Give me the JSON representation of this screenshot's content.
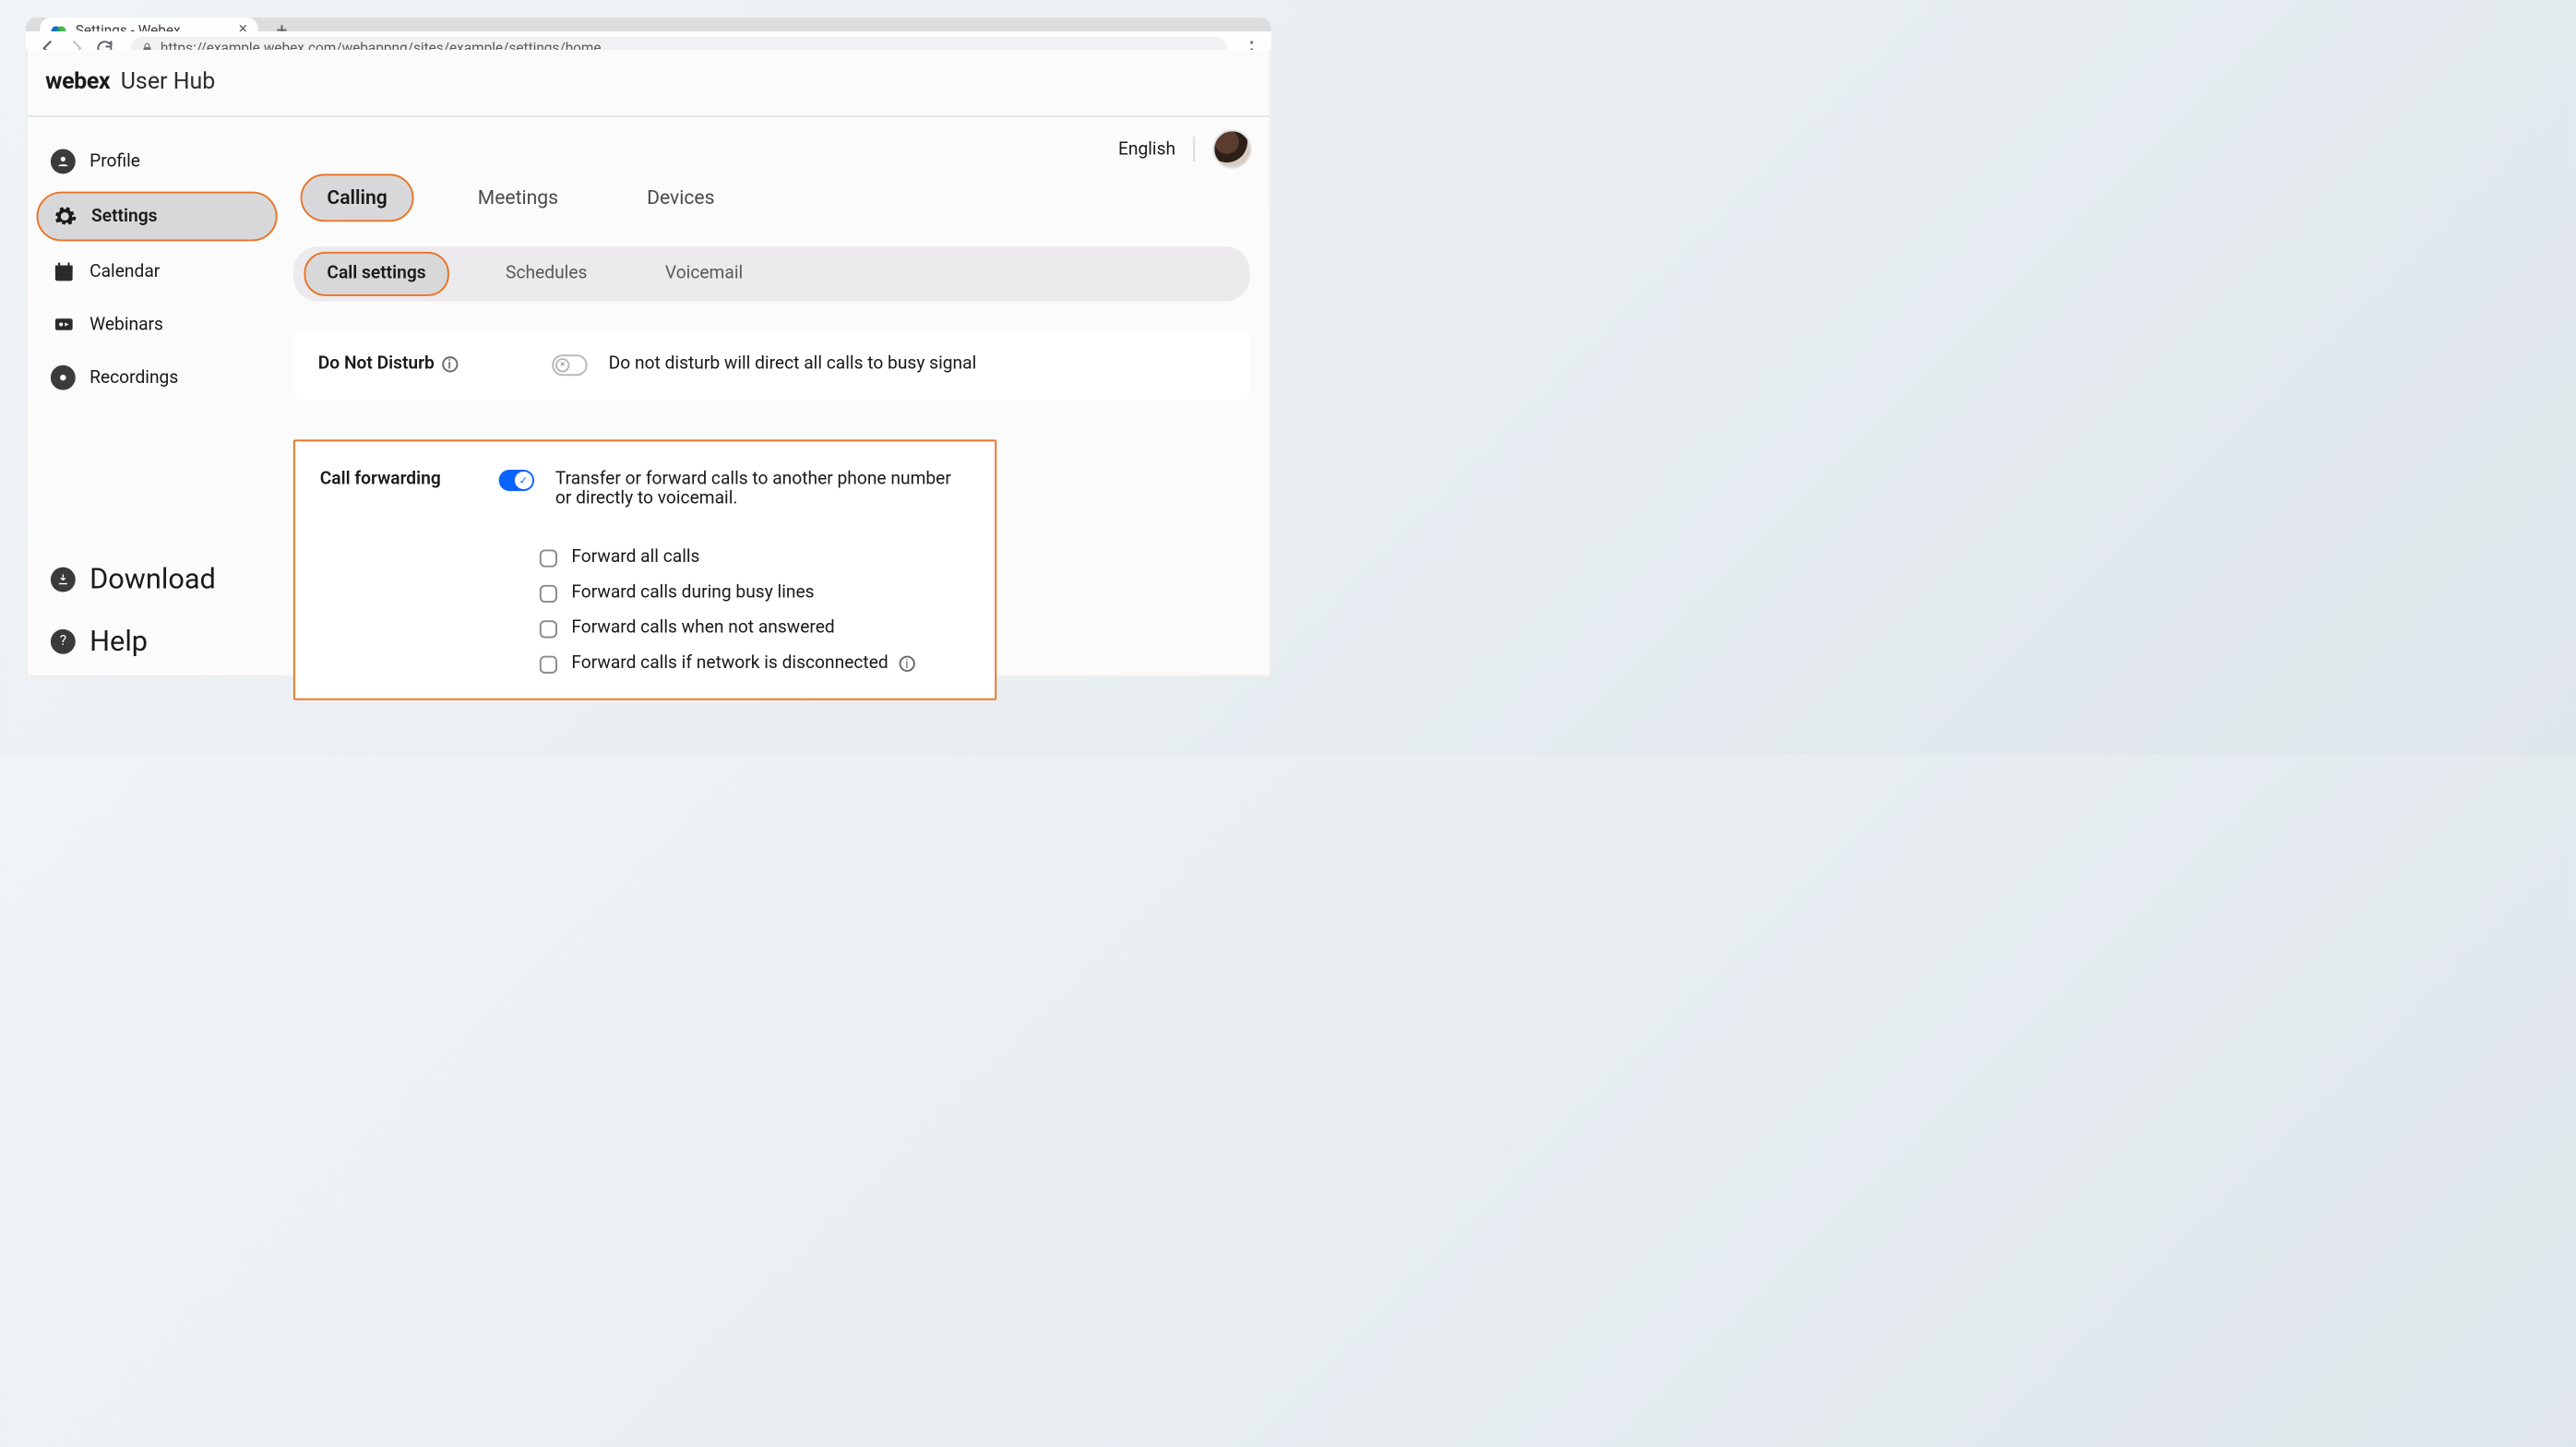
{
  "browser": {
    "tab_title": "Settings - Webex",
    "url": "https://example.webex.com/webappng/sites/example/settings/home"
  },
  "header": {
    "brand": "webex",
    "sub": "User Hub",
    "language": "English"
  },
  "sidebar": {
    "items": [
      {
        "label": "Profile"
      },
      {
        "label": "Settings"
      },
      {
        "label": "Calendar"
      },
      {
        "label": "Webinars"
      },
      {
        "label": "Recordings"
      }
    ],
    "bottom": [
      {
        "label": "Download"
      },
      {
        "label": "Help"
      }
    ]
  },
  "main_tabs": {
    "items": [
      {
        "label": "Calling"
      },
      {
        "label": "Meetings"
      },
      {
        "label": "Devices"
      }
    ]
  },
  "sub_tabs": {
    "items": [
      {
        "label": "Call settings"
      },
      {
        "label": "Schedules"
      },
      {
        "label": "Voicemail"
      }
    ]
  },
  "dnd": {
    "label": "Do Not Disturb",
    "desc": "Do not disturb will direct all calls to busy signal"
  },
  "call_forwarding": {
    "label": "Call forwarding",
    "desc": "Transfer or forward calls to another phone number or directly to voicemail.",
    "options": [
      {
        "label": "Forward all calls"
      },
      {
        "label": "Forward calls during busy lines"
      },
      {
        "label": "Forward calls when not answered"
      },
      {
        "label": "Forward calls if network is disconnected"
      }
    ]
  }
}
